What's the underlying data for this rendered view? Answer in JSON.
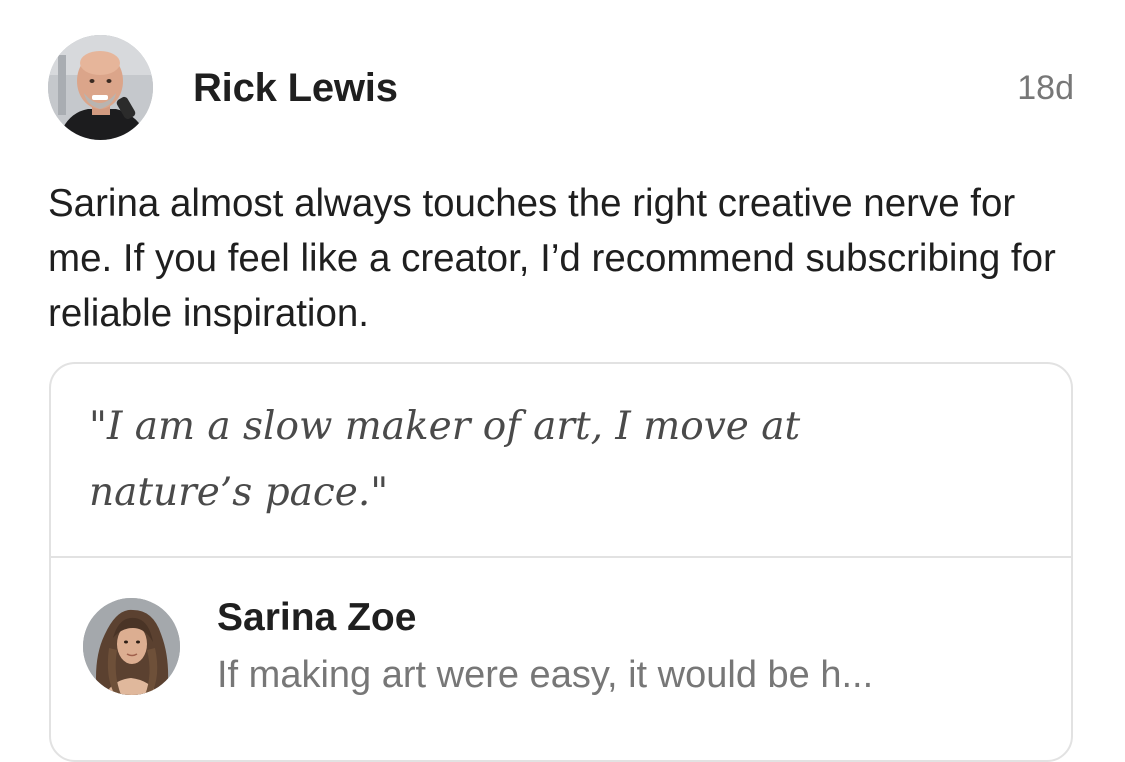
{
  "post": {
    "author": {
      "name": "Rick Lewis",
      "avatar_icon": "bald-man-avatar-photo"
    },
    "timestamp": "18d",
    "body": "Sarina almost always touches the right creative nerve for me. If you feel like a creator, I’d recommend subscribing for reliable inspiration.",
    "embed": {
      "quote": "\"I am a slow maker of art, I move at nature’s pace.\"",
      "author": {
        "name": "Sarina Zoe",
        "avatar_icon": "woman-long-hair-avatar-photo"
      },
      "excerpt": "If making art were easy, it would be h..."
    }
  },
  "colors": {
    "text_primary": "#1f1f1f",
    "text_secondary": "#777777",
    "quote_text": "#4a4a4a",
    "card_border": "#e2e2e2",
    "background": "#ffffff"
  }
}
